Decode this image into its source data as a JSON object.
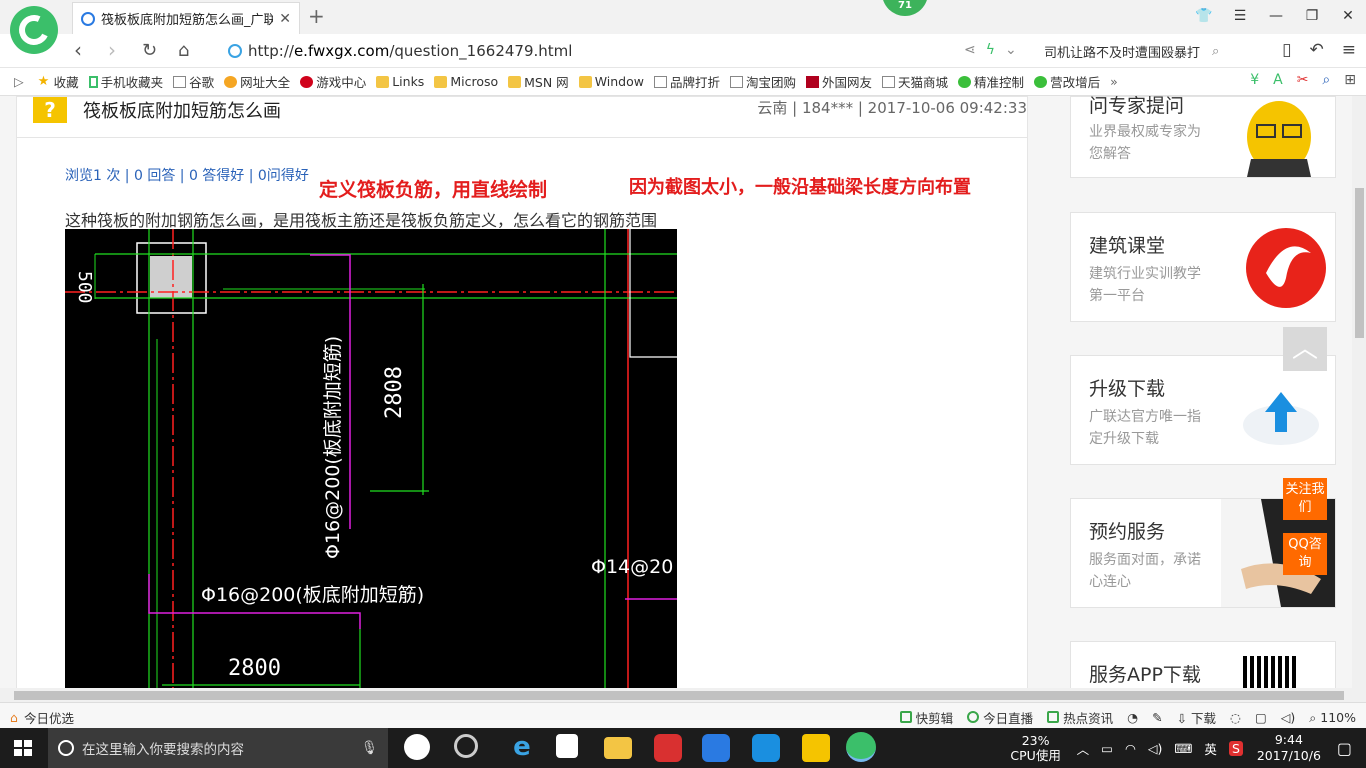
{
  "browser": {
    "tab_title": "筏板板底附加短筋怎么画_广联达",
    "badge_count": "71",
    "url_prefix": "http://",
    "url_host": "e.fwxgx.com",
    "url_path": "/question_1662479.html",
    "search_text": "司机让路不及时遭围殴暴打"
  },
  "bookmarks": [
    {
      "label": "收藏",
      "icon": "star-icon"
    },
    {
      "label": "手机收藏夹",
      "icon": "phone-icon"
    },
    {
      "label": "谷歌",
      "icon": "page-icon"
    },
    {
      "label": "网址大全",
      "icon": "globe-icon"
    },
    {
      "label": "游戏中心",
      "icon": "game-icon"
    },
    {
      "label": "Links",
      "icon": "folder-icon"
    },
    {
      "label": "Microso",
      "icon": "folder-icon"
    },
    {
      "label": "MSN 网",
      "icon": "folder-icon"
    },
    {
      "label": "Window",
      "icon": "folder-icon"
    },
    {
      "label": "品牌打折",
      "icon": "page-icon"
    },
    {
      "label": "淘宝团购",
      "icon": "page-icon"
    },
    {
      "label": "外国网友",
      "icon": "page-icon"
    },
    {
      "label": "天猫商城",
      "icon": "page-icon"
    },
    {
      "label": "精准控制",
      "icon": "wechat-icon"
    },
    {
      "label": "营改增后",
      "icon": "wechat-icon"
    }
  ],
  "question": {
    "title": "筏板板底附加短筋怎么画",
    "meta": "云南 | 184*** | 2017-10-06 09:42:33",
    "stats": "浏览1 次 | 0 回答 | 0 答得好 | 0问得好",
    "annotation_1": "定义筏板负筋，用直线绘制",
    "annotation_2": "因为截图太小，一般沿基础梁长度方向布置",
    "body": "这种筏板的附加钢筋怎么画，是用筏板主筋还是筏板负筋定义，怎么看它的钢筋范围"
  },
  "cad": {
    "dim_500": "500",
    "dim_2808": "2808",
    "dim_2800": "2800",
    "label_vertical": "Φ16@200(板底附加短筋)",
    "label_horizontal": "Φ16@200(板底附加短筋)",
    "label_right": "Φ14@20"
  },
  "sidebar": [
    {
      "title": "问专家提问",
      "desc": "业界最权威专家为您解答"
    },
    {
      "title": "建筑课堂",
      "desc": "建筑行业实训教学第一平台"
    },
    {
      "title": "升级下载",
      "desc": "广联达官方唯一指定升级下载"
    },
    {
      "title": "预约服务",
      "desc": "服务面对面，承诺心连心"
    },
    {
      "title": "服务APP下载",
      "desc": ""
    }
  ],
  "float": {
    "follow": "关注我们",
    "qq": "QQ咨询"
  },
  "statusbar": {
    "left": "今日优选",
    "items": [
      "快剪辑",
      "今日直播",
      "热点资讯"
    ],
    "download": "下载",
    "zoom": "110%"
  },
  "taskbar": {
    "search_placeholder": "在这里输入你要搜索的内容",
    "cpu_percent": "23%",
    "cpu_label": "CPU使用",
    "ime": "英",
    "time": "9:44",
    "date": "2017/10/6"
  },
  "colors": {
    "accent_green": "#3bbf6a",
    "link_blue": "#2a62b8",
    "annotation_red": "#e31d1d",
    "float_orange": "#ff6a00"
  }
}
